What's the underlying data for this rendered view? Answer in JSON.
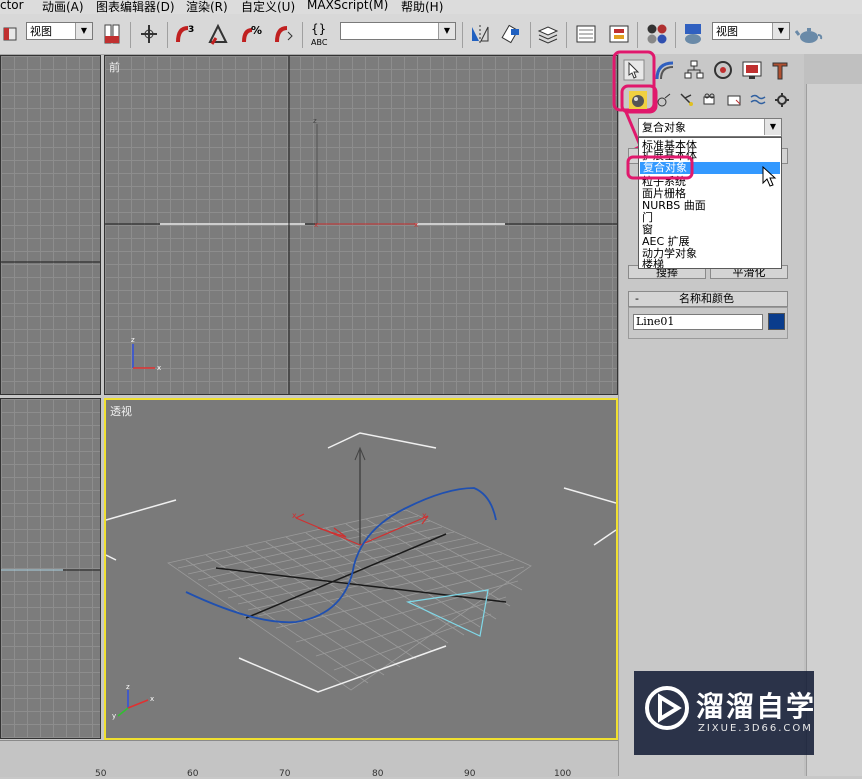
{
  "menu": {
    "items": [
      "ctor",
      "动画(A)",
      "图表编辑器(D)",
      "渲染(R)",
      "自定义(U)",
      "MAXScript(M)",
      "帮助(H)"
    ]
  },
  "toolbar": {
    "view_select": "视图",
    "view_select_right": "视图",
    "named_selection": "",
    "abc_label": "ABC"
  },
  "viewports": {
    "front_label": "前",
    "persp_label": "透视"
  },
  "command_panel": {
    "category_select": "复合对象",
    "dropdown_items": [
      "标准基本体",
      "扩展基本体",
      "复合对象",
      "粒子系统",
      "面片栅格",
      "NURBS 曲面",
      "门",
      "窗",
      "AEC 扩展",
      "动力学对象",
      "楼梯"
    ],
    "highlighted_index": 2,
    "hidden_buttons": [
      "搜捧",
      "平滑化"
    ],
    "name_color_header_minus": "-",
    "name_color_header": "名称和颜色",
    "object_name": "Line01",
    "object_color": "#0a3c8c"
  },
  "ruler": {
    "ticks": [
      "50",
      "60",
      "70",
      "80",
      "90",
      "100"
    ]
  },
  "watermark": {
    "title": "溜溜自学",
    "url": "ZIXUE.3D66.COM"
  },
  "colors": {
    "highlight": "#e0186c",
    "selected_viewport_border": "#f0e030",
    "dropdown_highlight": "#3399ff"
  }
}
